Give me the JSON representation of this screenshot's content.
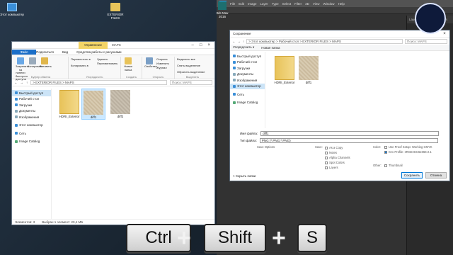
{
  "desktop": {
    "icons": [
      {
        "label": "Этот компьютер"
      },
      {
        "label": "EXTERIOR FILES"
      }
    ]
  },
  "explorer": {
    "title_tab": "Управление",
    "title": "MAPS",
    "tabs": [
      "Файл",
      "Главная",
      "Поделиться",
      "Вид",
      "Средства работы с рисунками"
    ],
    "ribbon": {
      "clip": [
        "Закрепить на панели быстрого доступа",
        "Копировать",
        "Вставить"
      ],
      "clip_small": [
        "Вырезать",
        "Скопировать путь",
        "Вставить ярлык"
      ],
      "clip_group": "Буфер обмена",
      "org": [
        "Переместить в",
        "Копировать в"
      ],
      "org2": [
        "Удалить",
        "Переименовать"
      ],
      "org_group": "Упорядочить",
      "new": [
        "Новая папка"
      ],
      "new_group": "Создать",
      "open": [
        "Свойства"
      ],
      "open_small": [
        "Открыть",
        "Изменить",
        "Журнал"
      ],
      "open_group": "Открыть",
      "sel": [
        "Выделить все",
        "Снять выделение",
        "Обратить выделение"
      ],
      "sel_group": "Выделить"
    },
    "path": "> EXTERIOR FILES > MAPS",
    "search": "Поиск: MAPS",
    "nav": [
      "Быстрый доступ",
      "Рабочий стол",
      "Загрузки",
      "Документы",
      "Изображения",
      "Этот компьютер",
      "Сеть",
      "Image Catalog"
    ],
    "files": [
      {
        "name": "HDRI_Exterior"
      },
      {
        "name": "diff1"
      },
      {
        "name": "diff2"
      }
    ],
    "status": [
      "Элементов: 3",
      "Выбран 1 элемент: 20,4 МБ"
    ]
  },
  "ps": {
    "menu": [
      "Ps",
      "File",
      "Edit",
      "Image",
      "Layer",
      "Type",
      "Select",
      "Filter",
      "3D",
      "View",
      "Window",
      "Help"
    ],
    "side": [
      "Layers",
      "Channels",
      "Paths"
    ],
    "desk_label": "3ds Max 2016"
  },
  "dialog": {
    "title": "Сохранение",
    "path": "> Этот компьютер > Рабочий стол > EXTERIOR FILES > MAPS",
    "search": "Поиск: MAPS",
    "toolbar": [
      "Упорядочить ▾",
      "Новая папка"
    ],
    "nav": [
      "Быстрый доступ",
      "Рабочий стол",
      "Загрузки",
      "Документы",
      "Изображения",
      "Этот компьютер",
      "Сеть",
      "Image Catalog"
    ],
    "files": [
      {
        "name": "HDRI_Exterior"
      },
      {
        "name": "diff1"
      }
    ],
    "filename_label": "Имя файла:",
    "filename_value": "diff1",
    "filetype_label": "Тип файла:",
    "filetype_value": "PNG (*.PNG;*.PNG)",
    "save_options": "Save Options",
    "save_label": "Save:",
    "save_items": [
      "As a Copy",
      "Notes",
      "Alpha Channels",
      "Spot Colors",
      "Layers"
    ],
    "color_label": "Color:",
    "color_items": [
      "Use Proof Setup: Working CMYK",
      "ICC Profile: sRGB IEC61966-2.1"
    ],
    "other_label": "Other:",
    "other_items": [
      "Thumbnail"
    ],
    "hide": "Скрыть папки",
    "save_btn": "Сохранить",
    "cancel_btn": "Отмена"
  },
  "keys": [
    "Ctrl",
    "+",
    "Shift",
    "+",
    "S"
  ]
}
